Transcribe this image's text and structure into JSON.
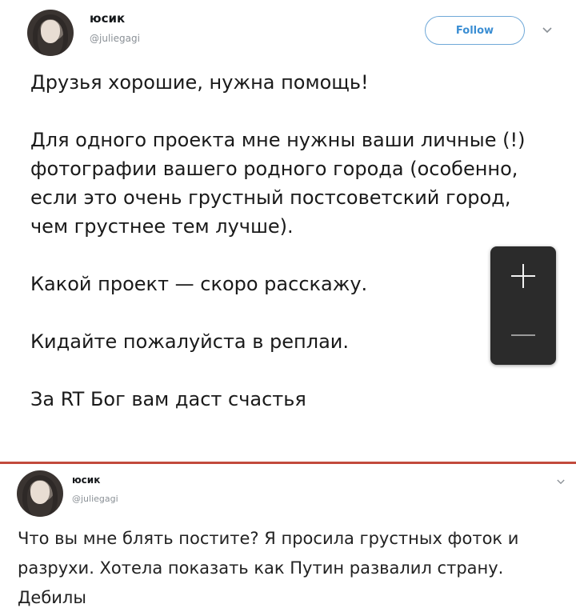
{
  "tweet1": {
    "author_name": "юсик",
    "handle": "@juliegagi",
    "follow_label": "Follow",
    "paragraphs": [
      "Друзья хорошие, нужна помощь!",
      "Для одного проекта мне нужны ваши личные (!) фотографии вашего родного города (особенно, если это очень грустный постсоветский город, чем грустнее тем лучше).",
      "Какой проект — скоро расскажу.",
      "Кидайте пожалуйста в реплаи.",
      "За RT Бог вам даст счастья"
    ]
  },
  "tweet2": {
    "author_name": "юсик",
    "handle": "@juliegagi",
    "text": "Что вы мне блять постите? Я просила грустных фоток и разрухи. Хотела показать как Путин развалил страну. Дебилы"
  },
  "icons": {
    "chevron": "chevron-down-icon",
    "zoom_in": "plus-icon",
    "zoom_out": "minus-icon"
  },
  "colors": {
    "accent": "#3b8ed3",
    "divider": "#c24a3c",
    "zoom_bg": "#2b2b2b"
  }
}
